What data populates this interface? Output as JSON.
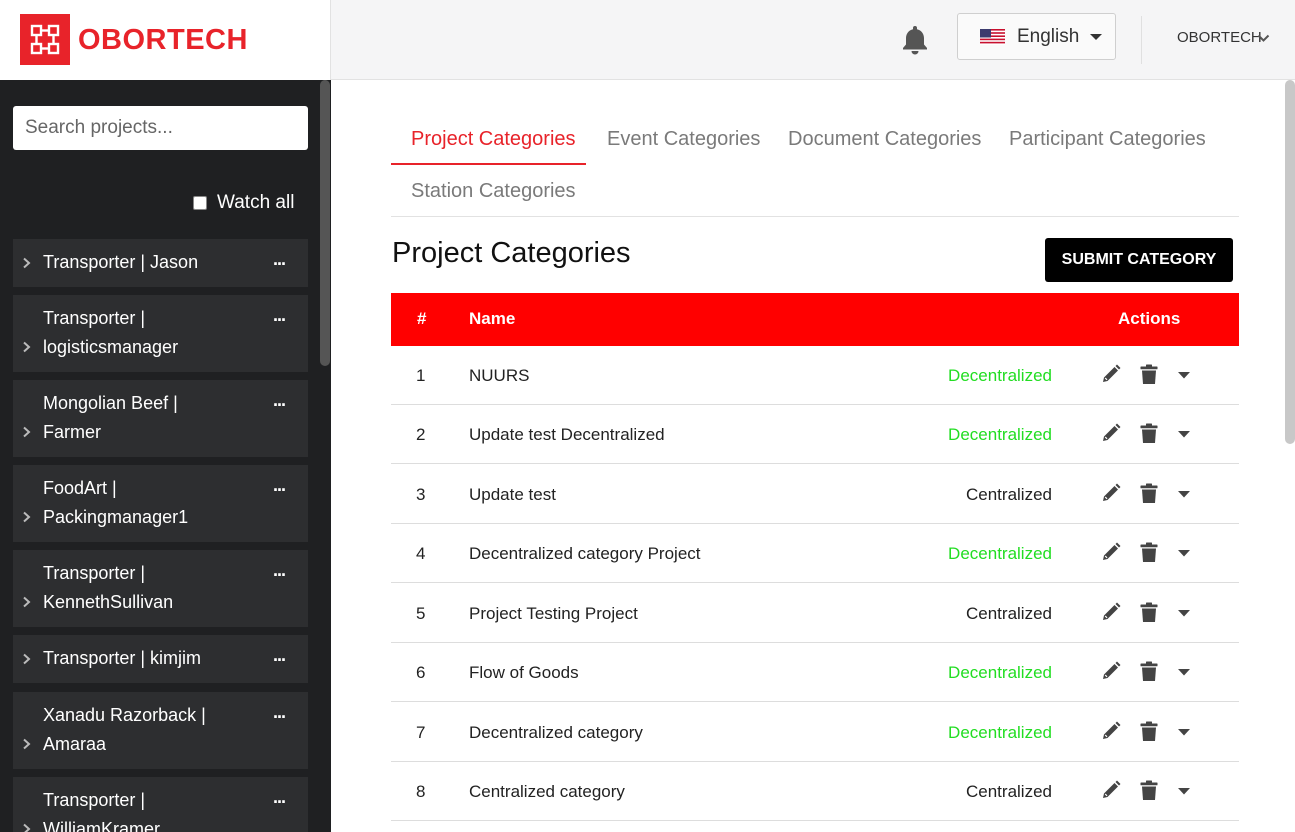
{
  "app": {
    "brand": "OBORTECH"
  },
  "header": {
    "language": "English",
    "user": "OBORTECH"
  },
  "sidebar": {
    "search_placeholder": "Search projects...",
    "watch_all": "Watch all",
    "projects": [
      {
        "line1": "Transporter | Jason",
        "line2": ""
      },
      {
        "line1": "Transporter |",
        "line2": "logisticsmanager"
      },
      {
        "line1": "Mongolian Beef |",
        "line2": "Farmer"
      },
      {
        "line1": "FoodArt |",
        "line2": "Packingmanager1"
      },
      {
        "line1": "Transporter |",
        "line2": "KennethSullivan"
      },
      {
        "line1": "Transporter | kimjim",
        "line2": ""
      },
      {
        "line1": "Xanadu Razorback |",
        "line2": "Amaraa"
      },
      {
        "line1": "Transporter |",
        "line2": "WilliamKramer"
      }
    ],
    "more_label": "..."
  },
  "tabs": [
    {
      "label": "Project Categories",
      "active": true
    },
    {
      "label": "Event Categories",
      "active": false
    },
    {
      "label": "Document Categories",
      "active": false
    },
    {
      "label": "Participant Categories",
      "active": false
    },
    {
      "label": "Station Categories",
      "active": false
    }
  ],
  "main": {
    "title": "Project Categories",
    "submit_label": "SUBMIT CATEGORY"
  },
  "table": {
    "headers": {
      "num": "#",
      "name": "Name",
      "actions": "Actions"
    },
    "rows": [
      {
        "num": "1",
        "name": "NUURS",
        "type": "Decentralized"
      },
      {
        "num": "2",
        "name": "Update test Decentralized",
        "type": "Decentralized"
      },
      {
        "num": "3",
        "name": "Update test",
        "type": "Centralized"
      },
      {
        "num": "4",
        "name": "Decentralized category Project",
        "type": "Decentralized"
      },
      {
        "num": "5",
        "name": "Project Testing Project",
        "type": "Centralized"
      },
      {
        "num": "6",
        "name": "Flow of Goods",
        "type": "Decentralized"
      },
      {
        "num": "7",
        "name": "Decentralized category",
        "type": "Decentralized"
      },
      {
        "num": "8",
        "name": "Centralized category",
        "type": "Centralized"
      }
    ]
  },
  "colors": {
    "brand": "#e8232a",
    "header_row": "#ff0000",
    "decentralized": "#22dd22",
    "centralized": "#222222"
  },
  "icons": {
    "notification": "bell-icon",
    "edit": "pencil-icon",
    "delete": "trash-icon",
    "expand": "caret-down-icon"
  }
}
